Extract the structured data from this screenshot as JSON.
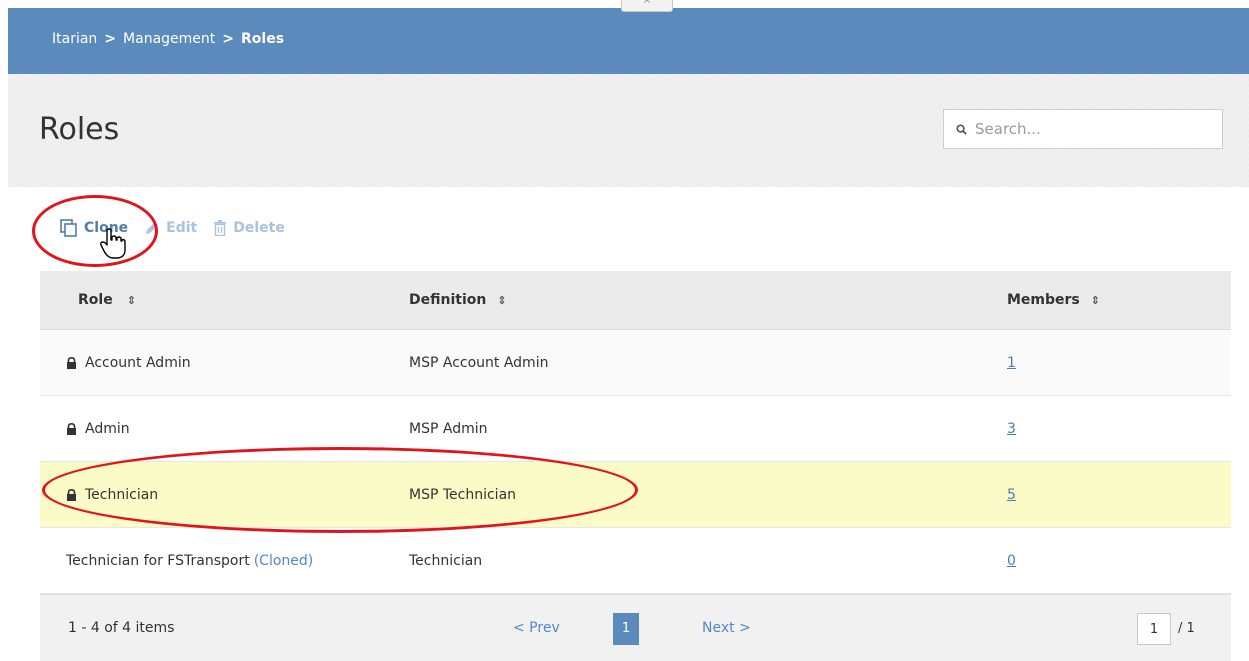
{
  "breadcrumb": {
    "items": [
      "Itarian",
      "Management",
      "Roles"
    ],
    "separator": ">"
  },
  "collapse_label": "^",
  "page": {
    "title": "Roles"
  },
  "search": {
    "placeholder": "Search...",
    "value": ""
  },
  "toolbar": {
    "clone_label": "Clone",
    "edit_label": "Edit",
    "delete_label": "Delete"
  },
  "table": {
    "columns": [
      {
        "label": "Role"
      },
      {
        "label": "Definition"
      },
      {
        "label": "Members"
      }
    ],
    "sort_icon": "⇕",
    "rows": [
      {
        "role": "Account Admin",
        "locked": true,
        "definition": "MSP Account Admin",
        "members": "1"
      },
      {
        "role": "Admin",
        "locked": true,
        "definition": "MSP Admin",
        "members": "3"
      },
      {
        "role": "Technician",
        "locked": true,
        "definition": "MSP Technician",
        "members": "5",
        "selected": true
      },
      {
        "role": "Technician for FSTransport",
        "role_tag": "(Cloned)",
        "locked": false,
        "definition": "Technician",
        "members": "0"
      }
    ]
  },
  "pagination": {
    "summary": "1 - 4 of 4 items",
    "prev": "< Prev",
    "current": "1",
    "next": "Next >",
    "page_input": "1",
    "total": "/ 1"
  },
  "colors": {
    "header_bg": "#5b8bbd",
    "selected_row": "#fbfbc8",
    "link": "#4f89c7",
    "annotation": "#e0141c"
  }
}
